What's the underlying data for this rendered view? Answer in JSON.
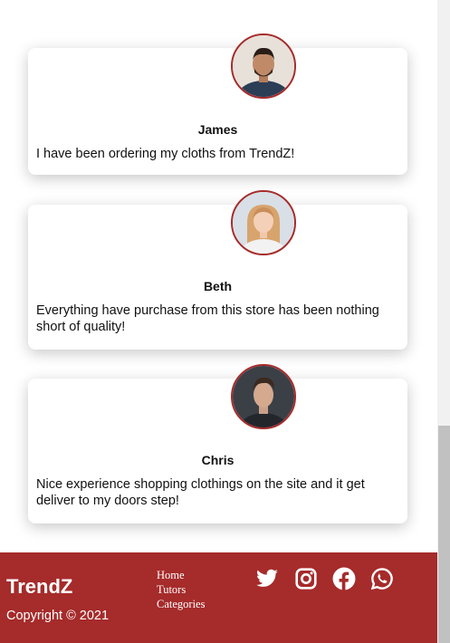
{
  "testimonials": [
    {
      "name": "James",
      "review": "I have been ordering my cloths from TrendZ!"
    },
    {
      "name": "Beth",
      "review": "Everything have purchase from this store has been nothing short of quality!"
    },
    {
      "name": "Chris",
      "review": "Nice experience shopping clothings on the site and it get deliver to my doors step!"
    }
  ],
  "footer": {
    "brand": "TrendZ",
    "copyright": "Copyright © 2021",
    "links": [
      "Home",
      "Tutors",
      "Categories"
    ],
    "social_icons": [
      "twitter-icon",
      "instagram-icon",
      "facebook-icon",
      "whatsapp-icon"
    ]
  },
  "colors": {
    "accent": "#a62b2b",
    "card_bg": "#ffffff",
    "text": "#111111"
  }
}
